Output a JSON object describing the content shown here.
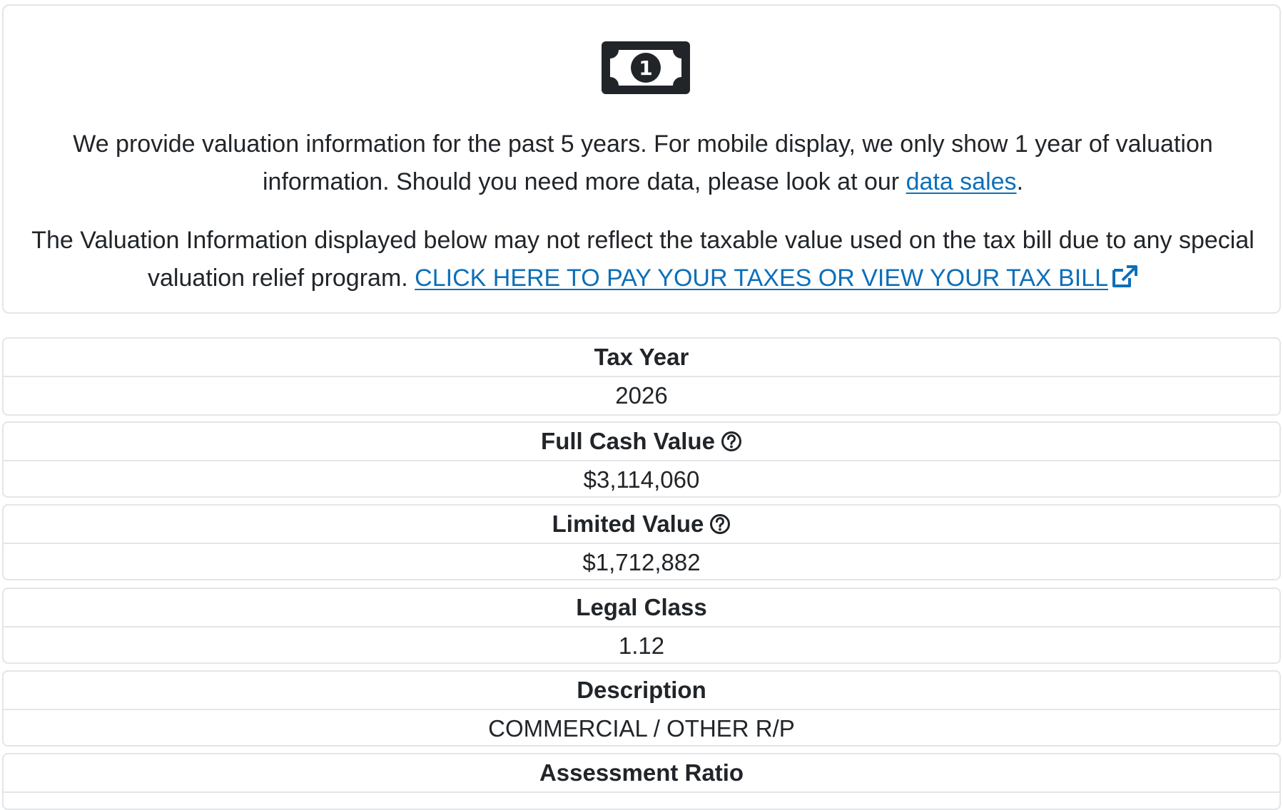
{
  "intro": {
    "icon": "money-bill-icon",
    "paragraph1_text": "We provide valuation information for the past 5 years. For mobile display, we only show 1 year of valuation information. Should you need more data, please look at our ",
    "data_sales_link": "data sales",
    "paragraph1_end": ".",
    "paragraph2_text": "The Valuation Information displayed below may not reflect the taxable value used on the tax bill due to any special valuation relief program. ",
    "pay_taxes_link": "CLICK HERE TO PAY YOUR TAXES OR VIEW YOUR TAX BILL",
    "link_color": "#0d6fb8"
  },
  "valuation": {
    "tax_year": {
      "label": "Tax Year",
      "value": "2026"
    },
    "full_cash_value": {
      "label": "Full Cash Value",
      "value": "$3,114,060",
      "icon": "question-circle-icon"
    },
    "limited_value": {
      "label": "Limited Value",
      "value": "$1,712,882",
      "icon": "question-circle-icon"
    },
    "legal_class": {
      "label": "Legal Class",
      "value": "1.12"
    },
    "description": {
      "label": "Description",
      "value": "COMMERCIAL / OTHER R/P"
    },
    "assessment_ratio": {
      "label": "Assessment Ratio"
    }
  }
}
